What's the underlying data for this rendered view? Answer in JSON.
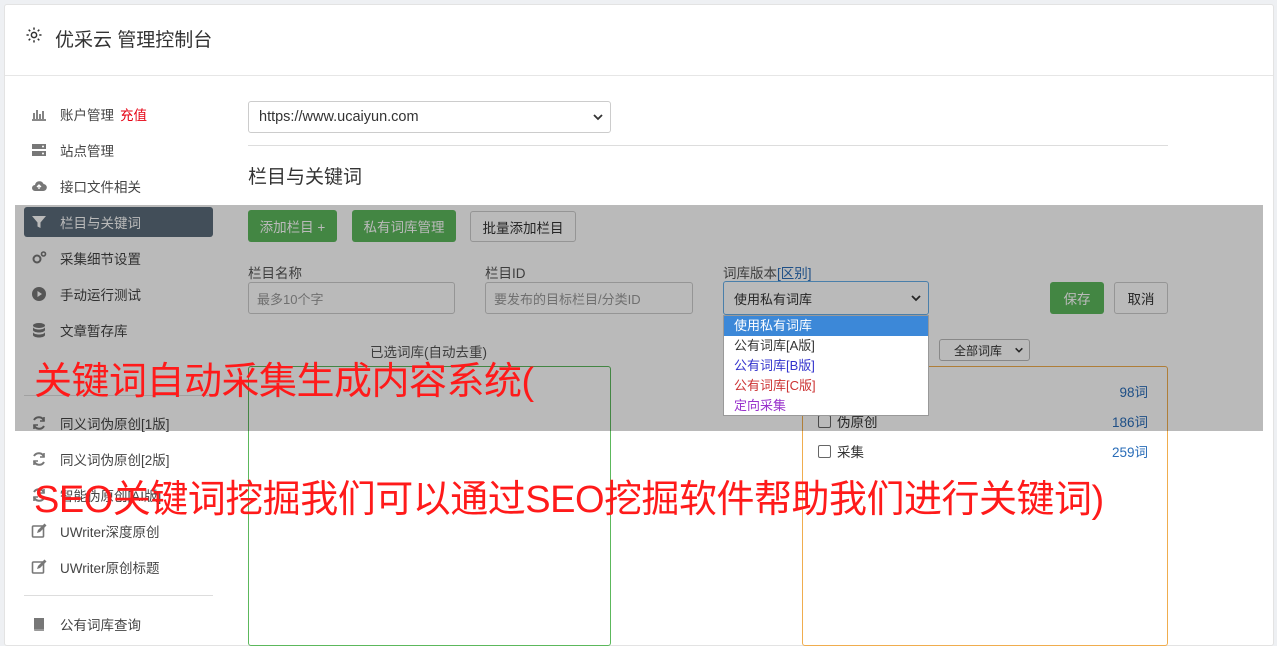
{
  "header": {
    "title": "优采云 管理控制台"
  },
  "sidebar": {
    "recharge_label": "充值",
    "items": [
      {
        "label": "账户管理",
        "icon": "bar-chart-icon"
      },
      {
        "label": "站点管理",
        "icon": "server-icon"
      },
      {
        "label": "接口文件相关",
        "icon": "cloud-upload-icon"
      },
      {
        "label": "栏目与关键词",
        "icon": "filter-icon",
        "active": true
      },
      {
        "label": "采集细节设置",
        "icon": "cogs-icon"
      },
      {
        "label": "手动运行测试",
        "icon": "play-circle-icon"
      },
      {
        "label": "文章暂存库",
        "icon": "database-icon"
      },
      {
        "label": "同义词伪原创[1版]",
        "icon": "refresh-icon"
      },
      {
        "label": "同义词伪原创[2版]",
        "icon": "refresh-icon"
      },
      {
        "label": "智能伪原创[AI版]",
        "icon": "refresh-icon"
      },
      {
        "label": "UWriter深度原创",
        "icon": "edit-icon"
      },
      {
        "label": "UWriter原创标题",
        "icon": "edit-icon"
      },
      {
        "label": "公有词库查询",
        "icon": "book-icon"
      }
    ]
  },
  "main": {
    "site_select_value": "https://www.ucaiyun.com",
    "section_title": "栏目与关键词",
    "buttons": {
      "add_column": "添加栏目 +",
      "private_lib": "私有词库管理",
      "batch_add": "批量添加栏目",
      "save": "保存",
      "cancel": "取消"
    },
    "form": {
      "name_label": "栏目名称",
      "name_placeholder": "最多10个字",
      "id_label": "栏目ID",
      "id_placeholder": "要发布的目标栏目/分类ID",
      "version_label": "词库版本",
      "version_link": "[区别]",
      "version_value": "使用私有词库"
    },
    "version_options": [
      {
        "label": "使用私有词库",
        "color": "#ffffff"
      },
      {
        "label": "公有词库[A版]",
        "color": "#333333"
      },
      {
        "label": "公有词库[B版]",
        "color": "#3333cc"
      },
      {
        "label": "公有词库[C版]",
        "color": "#cc3333"
      },
      {
        "label": "定向采集",
        "color": "#9933cc"
      }
    ],
    "selected_words_label": "已选词库(自动去重)",
    "lib_filter_value": "全部词库",
    "library_rows": [
      {
        "label": "",
        "count": "98词"
      },
      {
        "label": "伪原创",
        "count": "186词"
      },
      {
        "label": "采集",
        "count": "259词"
      }
    ]
  },
  "watermark": {
    "line1": "关键词自动采集生成内容系统(",
    "line2": "SEO关键词挖掘我们可以通过SEO挖掘软件帮助我们进行关键词)"
  }
}
